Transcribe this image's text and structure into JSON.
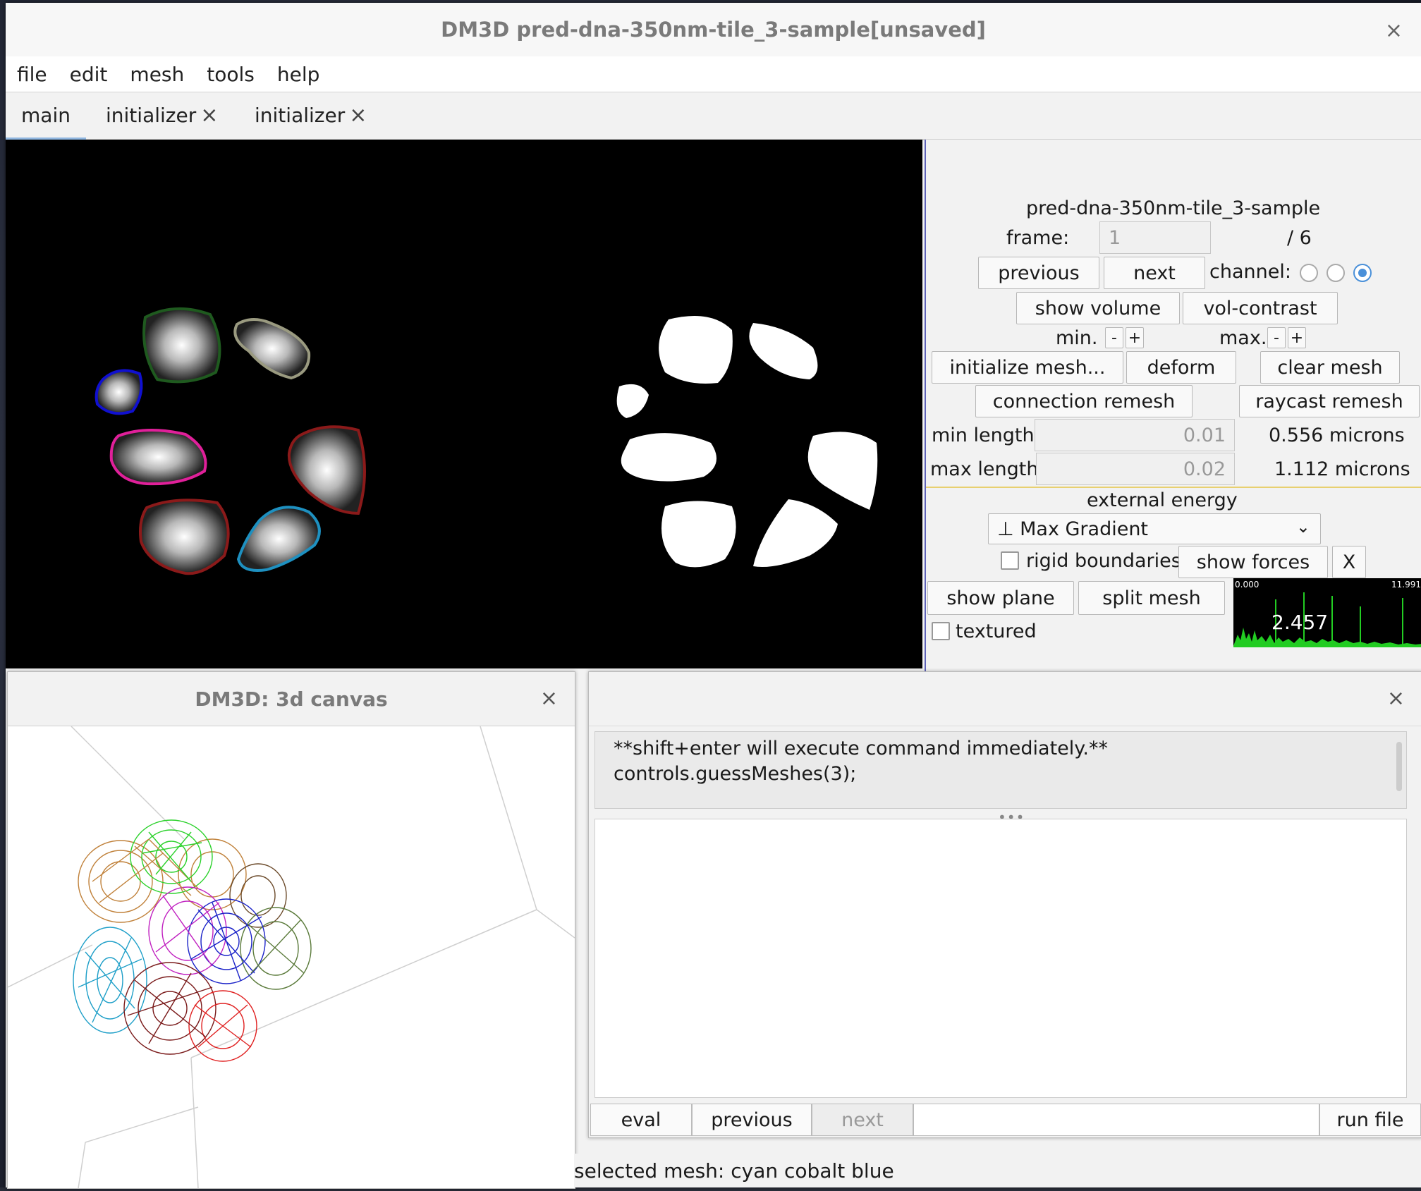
{
  "window": {
    "title": "DM3D pred-dna-350nm-tile_3-sample[unsaved]",
    "close": "×"
  },
  "menu": [
    "file",
    "edit",
    "mesh",
    "tools",
    "help"
  ],
  "tabs": [
    {
      "label": "main"
    },
    {
      "label": "initializer"
    },
    {
      "label": "initializer"
    }
  ],
  "tab_close": "×",
  "panel": {
    "image_name": "pred-dna-350nm-tile_3-sample",
    "frame_label": "frame:",
    "frame_value": "1",
    "frame_total": "/ 6",
    "previous": "previous",
    "next": "next",
    "channel_label": "channel:",
    "show_volume": "show volume",
    "vol_contrast": "vol-contrast",
    "min_label": "min.",
    "max_label": "max.",
    "minus": "-",
    "plus": "+",
    "initialize_mesh": "initialize mesh...",
    "deform": "deform",
    "clear_mesh": "clear mesh",
    "connection_remesh": "connection remesh",
    "raycast_remesh": "raycast remesh",
    "min_length_label": "min length",
    "min_length_value": "0.01",
    "min_length_microns": "0.556 microns",
    "max_length_label": "max length",
    "max_length_value": "0.02",
    "max_length_microns": "1.112 microns",
    "external_energy_label": "external energy",
    "external_energy_value": "⊥ Max Gradient",
    "rigid_boundaries": "rigid boundaries",
    "show_forces": "show forces",
    "x_button": "X",
    "show_plane": "show plane",
    "split_mesh": "split mesh",
    "textured": "textured",
    "histogram": {
      "min": "0.000",
      "max": "11.991",
      "value": "2.457"
    }
  },
  "canvas3d": {
    "title": "DM3D: 3d canvas",
    "close": "×"
  },
  "script": {
    "close": "×",
    "output_line1": "**shift+enter will execute command immediately.**",
    "output_line2": "controls.guessMeshes(3);",
    "eval": "eval",
    "previous": "previous",
    "next": "next",
    "run_file": "run file"
  },
  "status": "selected mesh:  cyan cobalt blue",
  "colors": {
    "accent": "#4a90d9",
    "mesh_green": "#1f5a1f",
    "mesh_grey": "#9a9a80",
    "mesh_blue": "#1010d0",
    "mesh_magenta": "#e0209a",
    "mesh_red": "#8b1a1a",
    "mesh_cyan": "#1e90c0",
    "histogram": "#22cc22"
  }
}
